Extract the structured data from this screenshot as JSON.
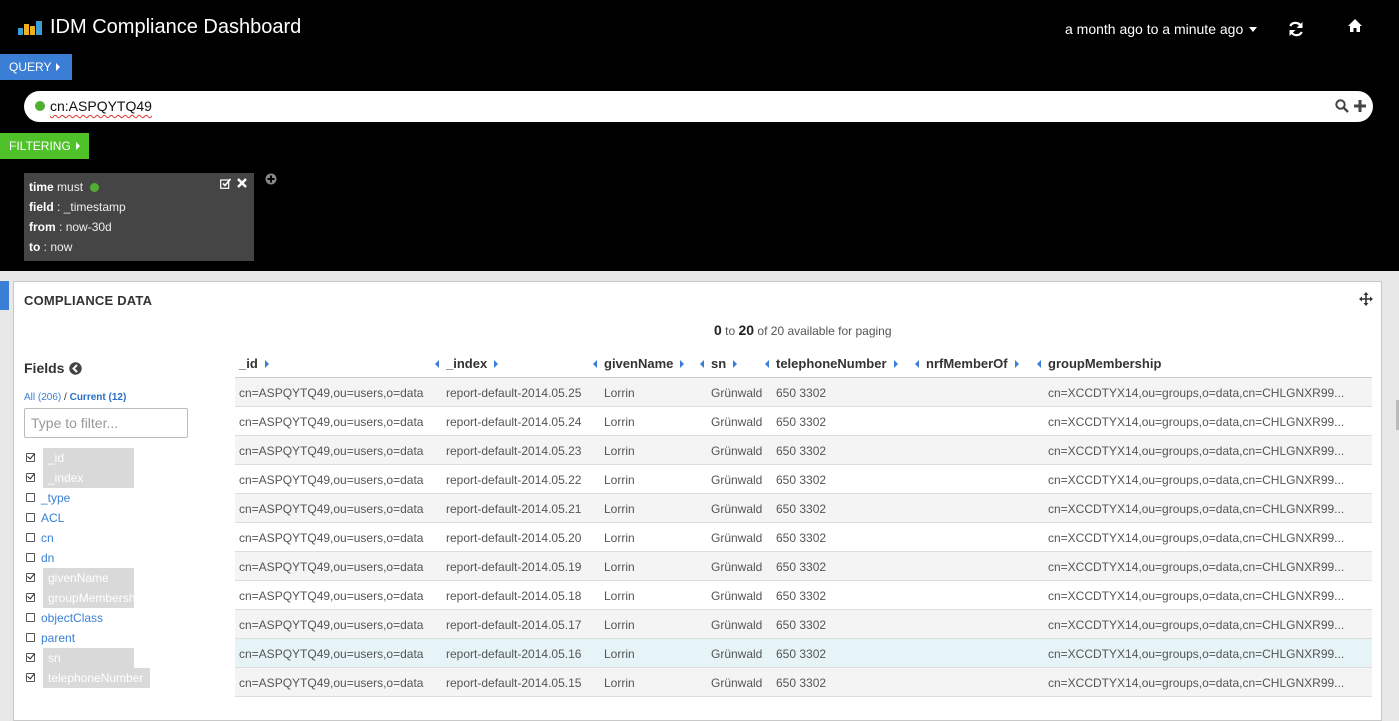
{
  "header": {
    "title": "IDM Compliance Dashboard",
    "time_range": "a month ago to a minute ago",
    "icons": {
      "logo": "bar-chart-logo",
      "refresh": "refresh-icon",
      "home": "home-icon"
    }
  },
  "query": {
    "tab_label": "QUERY",
    "value": "cn:ASPQYTQ49",
    "status_color": "#4fb030"
  },
  "filtering": {
    "tab_label": "FILTERING",
    "filter": {
      "type_key": "time",
      "mode": "must",
      "field_key": "field",
      "field_value": "_timestamp",
      "from_key": "from",
      "from_value": "now-30d",
      "to_key": "to",
      "to_value": "now"
    }
  },
  "panel": {
    "title": "COMPLIANCE DATA",
    "paging": {
      "from": "0",
      "to_word": "to",
      "to": "20",
      "suffix": "of 20 available for paging"
    }
  },
  "fields": {
    "title": "Fields",
    "tab_all": "All (206)",
    "separator": "/",
    "tab_current": "Current (12)",
    "filter_placeholder": "Type to filter...",
    "items": [
      {
        "name": "_id",
        "checked": true
      },
      {
        "name": "_index",
        "checked": true
      },
      {
        "name": "_type",
        "checked": false
      },
      {
        "name": "ACL",
        "checked": false
      },
      {
        "name": "cn",
        "checked": false
      },
      {
        "name": "dn",
        "checked": false
      },
      {
        "name": "givenName",
        "checked": true
      },
      {
        "name": "groupMembership",
        "checked": true
      },
      {
        "name": "objectClass",
        "checked": false
      },
      {
        "name": "parent",
        "checked": false
      },
      {
        "name": "sn",
        "checked": true
      },
      {
        "name": "telephoneNumber",
        "checked": true
      }
    ]
  },
  "table": {
    "columns": [
      "_id",
      "_index",
      "givenName",
      "sn",
      "telephoneNumber",
      "nrfMemberOf",
      "groupMembership"
    ],
    "rows": [
      [
        "cn=ASPQYTQ49,ou=users,o=data",
        "report-default-2014.05.25",
        "Lorrin",
        "Grünwald",
        "650 3302",
        "",
        "cn=XCCDTYX14,ou=groups,o=data,cn=CHLGNXR99..."
      ],
      [
        "cn=ASPQYTQ49,ou=users,o=data",
        "report-default-2014.05.24",
        "Lorrin",
        "Grünwald",
        "650 3302",
        "",
        "cn=XCCDTYX14,ou=groups,o=data,cn=CHLGNXR99..."
      ],
      [
        "cn=ASPQYTQ49,ou=users,o=data",
        "report-default-2014.05.23",
        "Lorrin",
        "Grünwald",
        "650 3302",
        "",
        "cn=XCCDTYX14,ou=groups,o=data,cn=CHLGNXR99..."
      ],
      [
        "cn=ASPQYTQ49,ou=users,o=data",
        "report-default-2014.05.22",
        "Lorrin",
        "Grünwald",
        "650 3302",
        "",
        "cn=XCCDTYX14,ou=groups,o=data,cn=CHLGNXR99..."
      ],
      [
        "cn=ASPQYTQ49,ou=users,o=data",
        "report-default-2014.05.21",
        "Lorrin",
        "Grünwald",
        "650 3302",
        "",
        "cn=XCCDTYX14,ou=groups,o=data,cn=CHLGNXR99..."
      ],
      [
        "cn=ASPQYTQ49,ou=users,o=data",
        "report-default-2014.05.20",
        "Lorrin",
        "Grünwald",
        "650 3302",
        "",
        "cn=XCCDTYX14,ou=groups,o=data,cn=CHLGNXR99..."
      ],
      [
        "cn=ASPQYTQ49,ou=users,o=data",
        "report-default-2014.05.19",
        "Lorrin",
        "Grünwald",
        "650 3302",
        "",
        "cn=XCCDTYX14,ou=groups,o=data,cn=CHLGNXR99..."
      ],
      [
        "cn=ASPQYTQ49,ou=users,o=data",
        "report-default-2014.05.18",
        "Lorrin",
        "Grünwald",
        "650 3302",
        "",
        "cn=XCCDTYX14,ou=groups,o=data,cn=CHLGNXR99..."
      ],
      [
        "cn=ASPQYTQ49,ou=users,o=data",
        "report-default-2014.05.17",
        "Lorrin",
        "Grünwald",
        "650 3302",
        "",
        "cn=XCCDTYX14,ou=groups,o=data,cn=CHLGNXR99..."
      ],
      [
        "cn=ASPQYTQ49,ou=users,o=data",
        "report-default-2014.05.16",
        "Lorrin",
        "Grünwald",
        "650 3302",
        "",
        "cn=XCCDTYX14,ou=groups,o=data,cn=CHLGNXR99..."
      ],
      [
        "cn=ASPQYTQ49,ou=users,o=data",
        "report-default-2014.05.15",
        "Lorrin",
        "Grünwald",
        "650 3302",
        "",
        "cn=XCCDTYX14,ou=groups,o=data,cn=CHLGNXR99..."
      ]
    ],
    "highlighted_row": 9
  }
}
